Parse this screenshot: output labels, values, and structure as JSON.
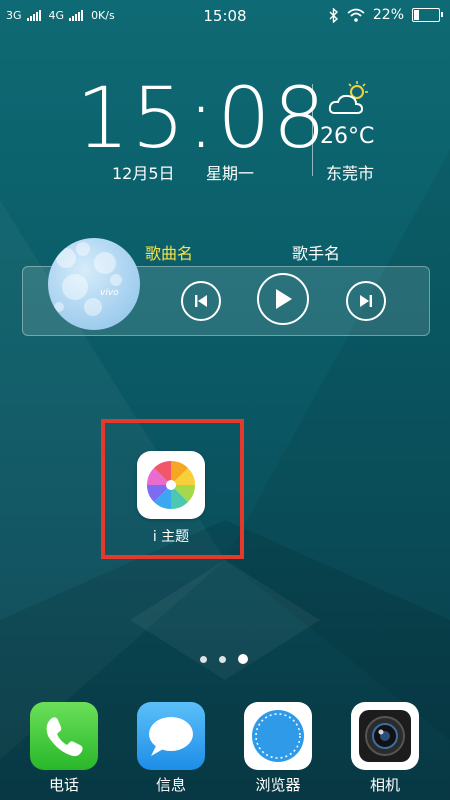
{
  "status_bar": {
    "network1": "3G",
    "network2": "4G",
    "speed": "0K/s",
    "time": "15:08",
    "battery": "22%",
    "battery_level": 0.22
  },
  "clock": {
    "time": "15:08",
    "date": "12月5日",
    "weekday": "星期一"
  },
  "weather": {
    "icon": "partly-cloudy-icon",
    "temperature": "26°C",
    "city": "东莞市"
  },
  "music_widget": {
    "song": "歌曲名",
    "artist": "歌手名",
    "album_brand": "vivo",
    "controls": [
      "previous-icon",
      "play-icon",
      "next-icon"
    ]
  },
  "home_apps": [
    {
      "label": "i 主题",
      "icon": "pinwheel-icon"
    }
  ],
  "page_indicator": {
    "count": 3,
    "active": 2
  },
  "dock": [
    {
      "label": "电话",
      "icon": "phone-icon",
      "color": "#3fcf3a"
    },
    {
      "label": "信息",
      "icon": "message-icon",
      "color": "#2d9ff0"
    },
    {
      "label": "浏览器",
      "icon": "compass-icon",
      "color": "#ffffff"
    },
    {
      "label": "相机",
      "icon": "camera-icon",
      "color": "#ffffff"
    }
  ],
  "colors": {
    "highlight": "#e43a2d",
    "song_text": "#f4e24a"
  }
}
